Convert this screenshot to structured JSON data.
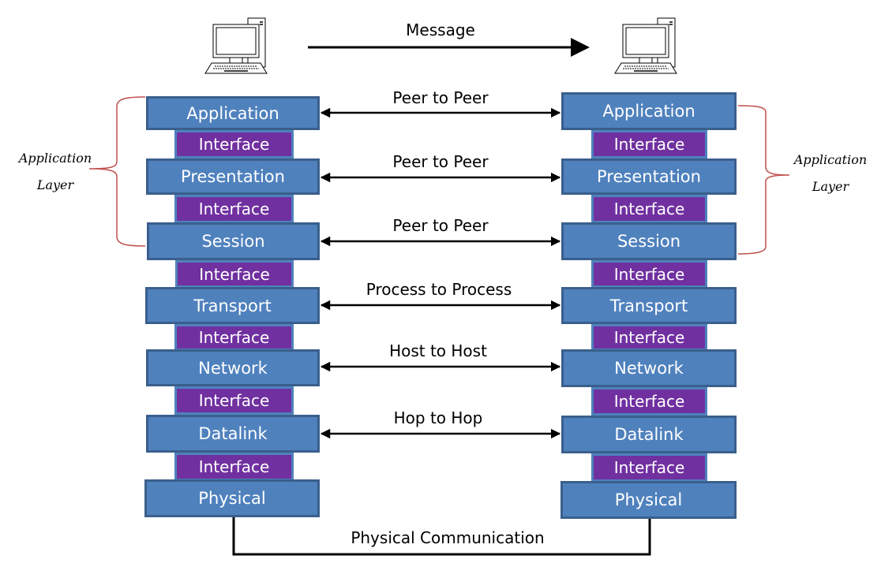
{
  "message_label": "Message",
  "side_label": {
    "line1": "Application",
    "line2": "Layer"
  },
  "stack_left": {
    "layers": [
      "Application",
      "Presentation",
      "Session",
      "Transport",
      "Network",
      "Datalink",
      "Physical"
    ],
    "interface_label": "Interface"
  },
  "stack_right": {
    "layers": [
      "Application",
      "Presentation",
      "Session",
      "Transport",
      "Network",
      "Datalink",
      "Physical"
    ],
    "interface_label": "Interface"
  },
  "peer_links": [
    "Peer to Peer",
    "Peer to Peer",
    "Peer to Peer",
    "Process to Process",
    "Host to Host",
    "Hop to Hop"
  ],
  "physical_link": "Physical Communication",
  "colors": {
    "layer": "#4f81bd",
    "layer_border": "#3a5f8c",
    "interface": "#7030a0",
    "brace": "#c0504d"
  }
}
